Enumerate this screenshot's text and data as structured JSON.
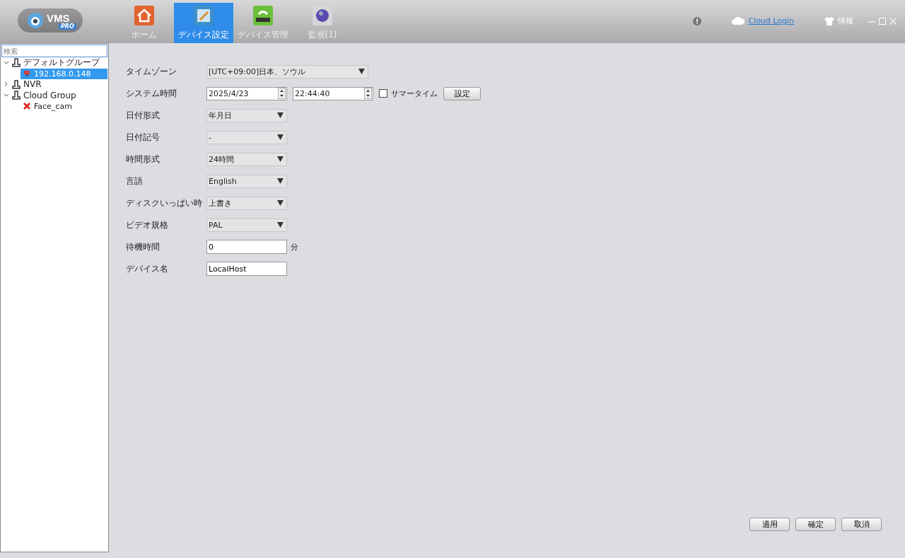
{
  "app": {
    "logo_text": "VMS",
    "logo_badge": "PRO"
  },
  "nav_tabs": [
    {
      "label": "ホーム",
      "selected": false,
      "kind": "home"
    },
    {
      "label": "デバイス設定",
      "selected": true,
      "kind": "settings"
    },
    {
      "label": "デバイス管理",
      "selected": false,
      "kind": "manage"
    },
    {
      "label": "監視(1)",
      "selected": false,
      "kind": "monitor"
    }
  ],
  "top_bar": {
    "cloud_login": "Cloud Login",
    "info": "情報"
  },
  "sidebar": {
    "search_placeholder": "検索",
    "tree": [
      {
        "label": "デフォルトグループ",
        "expanded": true,
        "children": [
          {
            "label": "192.168.0.148",
            "selected": true,
            "online": true
          }
        ]
      },
      {
        "label": "NVR",
        "expanded": false
      },
      {
        "label": "Cloud Group",
        "expanded": true,
        "children": [
          {
            "label": "Face_cam",
            "selected": false,
            "online": false
          }
        ]
      }
    ]
  },
  "form": [
    {
      "kind": "select",
      "label": "タイムゾーン",
      "value": "[UTC+09:00]日本、ソウル",
      "wide": true
    },
    {
      "kind": "datetime",
      "label": "システム時間",
      "date": "2025/4/23",
      "time": "22:44:40",
      "dst_label": "サマータイム",
      "dst_checked": false,
      "button": "設定"
    },
    {
      "kind": "select",
      "label": "日付形式",
      "value": "年月日",
      "wide": false
    },
    {
      "kind": "select",
      "label": "日付記号",
      "value": "-",
      "wide": false
    },
    {
      "kind": "select",
      "label": "時間形式",
      "value": "24時間",
      "wide": false
    },
    {
      "kind": "select",
      "label": "言語",
      "value": "English",
      "wide": false
    },
    {
      "kind": "select",
      "label": "ディスクいっぱい時",
      "value": "上書き",
      "wide": false
    },
    {
      "kind": "select",
      "label": "ビデオ規格",
      "value": "PAL",
      "wide": false
    },
    {
      "kind": "input",
      "label": "待機時間",
      "value": "0",
      "unit": "分"
    },
    {
      "kind": "input",
      "label": "デバイス名",
      "value": "LocalHost"
    }
  ],
  "buttons": [
    "適用",
    "確定",
    "取消"
  ]
}
